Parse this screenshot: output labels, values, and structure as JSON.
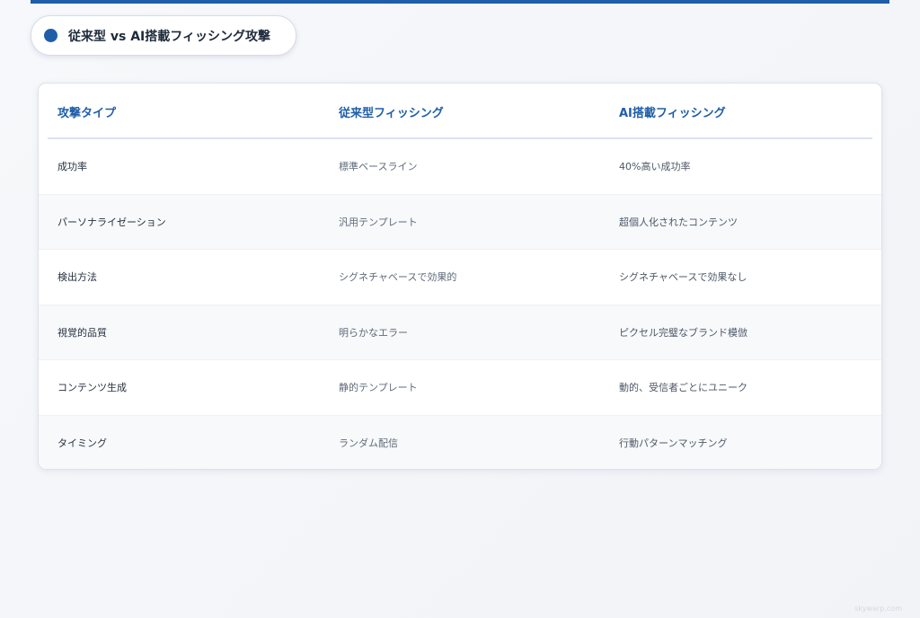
{
  "title": "従来型 vs AI搭載フィッシング攻撃",
  "table": {
    "headers": [
      "攻撃タイプ",
      "従来型フィッシング",
      "AI搭載フィッシング"
    ],
    "rows": [
      [
        "成功率",
        "標準ベースライン",
        "40%高い成功率"
      ],
      [
        "パーソナライゼーション",
        "汎用テンプレート",
        "超個人化されたコンテンツ"
      ],
      [
        "検出方法",
        "シグネチャベースで効果的",
        "シグネチャベースで効果なし"
      ],
      [
        "視覚的品質",
        "明らかなエラー",
        "ピクセル完璧なブランド模倣"
      ],
      [
        "コンテンツ生成",
        "静的テンプレート",
        "動的、受信者ごとにユニーク"
      ],
      [
        "タイミング",
        "ランダム配信",
        "行動パターンマッチング"
      ]
    ]
  },
  "watermark": "skywarp.com",
  "colors": {
    "accent": "#1f5ea8"
  }
}
